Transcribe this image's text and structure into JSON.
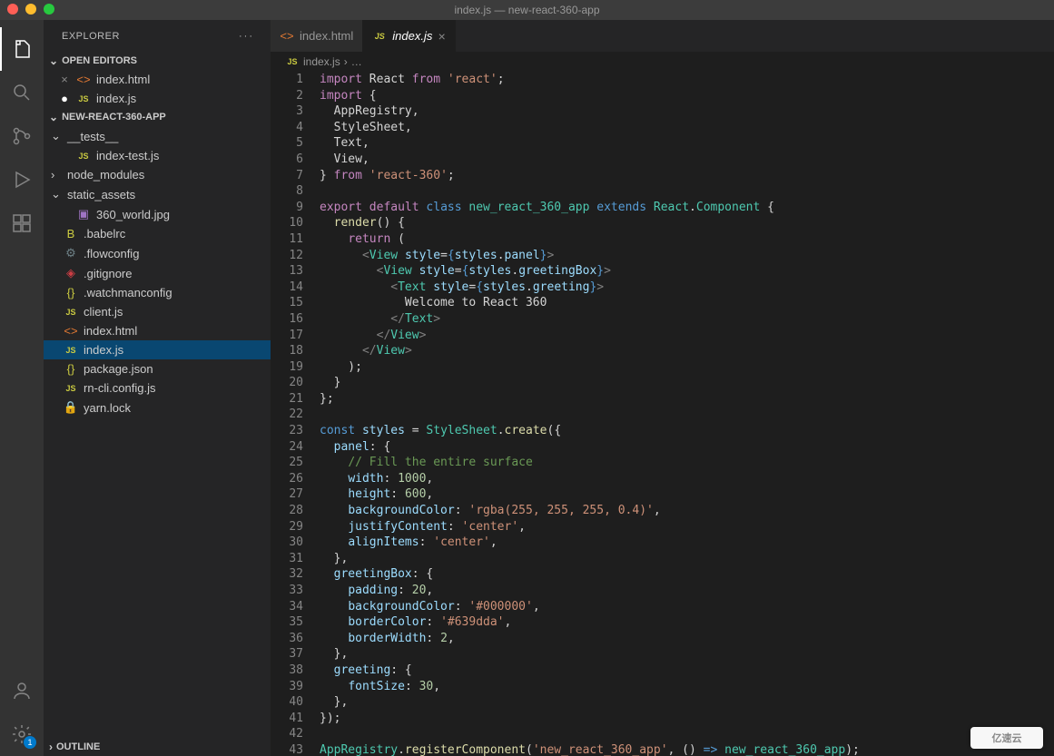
{
  "window": {
    "title": "index.js — new-react-360-app"
  },
  "activity": {
    "icons": [
      "files",
      "search",
      "scm",
      "debug",
      "extensions"
    ],
    "bottom": [
      "account",
      "gear"
    ],
    "badge": "1"
  },
  "sidebar": {
    "title": "EXPLORER",
    "sections": {
      "openEditors": {
        "label": "OPEN EDITORS",
        "items": [
          {
            "name": "index.html",
            "icon": "html",
            "modified": false
          },
          {
            "name": "index.js",
            "icon": "js",
            "modified": true
          }
        ]
      },
      "workspace": {
        "label": "NEW-REACT-360-APP",
        "tree": [
          {
            "name": "__tests__",
            "icon": "folder",
            "indent": 0,
            "chev": "down"
          },
          {
            "name": "index-test.js",
            "icon": "js",
            "indent": 1
          },
          {
            "name": "node_modules",
            "icon": "folder",
            "indent": 0,
            "chev": "right"
          },
          {
            "name": "static_assets",
            "icon": "folder",
            "indent": 0,
            "chev": "down"
          },
          {
            "name": "360_world.jpg",
            "icon": "img",
            "indent": 1
          },
          {
            "name": ".babelrc",
            "icon": "babel",
            "indent": 0
          },
          {
            "name": ".flowconfig",
            "icon": "conf",
            "indent": 0
          },
          {
            "name": ".gitignore",
            "icon": "git",
            "indent": 0
          },
          {
            "name": ".watchmanconfig",
            "icon": "json",
            "indent": 0
          },
          {
            "name": "client.js",
            "icon": "js",
            "indent": 0
          },
          {
            "name": "index.html",
            "icon": "html",
            "indent": 0
          },
          {
            "name": "index.js",
            "icon": "js",
            "indent": 0,
            "selected": true
          },
          {
            "name": "package.json",
            "icon": "json",
            "indent": 0
          },
          {
            "name": "rn-cli.config.js",
            "icon": "js",
            "indent": 0
          },
          {
            "name": "yarn.lock",
            "icon": "lock",
            "indent": 0
          }
        ]
      },
      "outline": {
        "label": "OUTLINE"
      }
    }
  },
  "tabs": [
    {
      "name": "index.html",
      "icon": "html",
      "active": false
    },
    {
      "name": "index.js",
      "icon": "js",
      "active": true
    }
  ],
  "breadcrumb": {
    "file": "index.js",
    "sep": "›",
    "rest": "…"
  },
  "code": {
    "lines": [
      [
        [
          "k",
          "import"
        ],
        [
          "punc",
          " React "
        ],
        [
          "k",
          "from"
        ],
        [
          "punc",
          " "
        ],
        [
          "str",
          "'react'"
        ],
        [
          "punc",
          ";"
        ]
      ],
      [
        [
          "k",
          "import"
        ],
        [
          "punc",
          " {"
        ]
      ],
      [
        [
          "punc",
          "  AppRegistry,"
        ]
      ],
      [
        [
          "punc",
          "  StyleSheet,"
        ]
      ],
      [
        [
          "punc",
          "  Text,"
        ]
      ],
      [
        [
          "punc",
          "  View,"
        ]
      ],
      [
        [
          "punc",
          "} "
        ],
        [
          "k",
          "from"
        ],
        [
          "punc",
          " "
        ],
        [
          "str",
          "'react-360'"
        ],
        [
          "punc",
          ";"
        ]
      ],
      [],
      [
        [
          "k",
          "export"
        ],
        [
          "punc",
          " "
        ],
        [
          "k",
          "default"
        ],
        [
          "punc",
          " "
        ],
        [
          "kb",
          "class"
        ],
        [
          "punc",
          " "
        ],
        [
          "ty",
          "new_react_360_app"
        ],
        [
          "punc",
          " "
        ],
        [
          "kb",
          "extends"
        ],
        [
          "punc",
          " "
        ],
        [
          "ty",
          "React"
        ],
        [
          "punc",
          "."
        ],
        [
          "ty",
          "Component"
        ],
        [
          "punc",
          " {"
        ]
      ],
      [
        [
          "punc",
          "  "
        ],
        [
          "fn",
          "render"
        ],
        [
          "punc",
          "() {"
        ]
      ],
      [
        [
          "punc",
          "    "
        ],
        [
          "k",
          "return"
        ],
        [
          "punc",
          " ("
        ]
      ],
      [
        [
          "punc",
          "      "
        ],
        [
          "pb",
          "<"
        ],
        [
          "tag",
          "View"
        ],
        [
          "punc",
          " "
        ],
        [
          "attr",
          "style"
        ],
        [
          "punc",
          "="
        ],
        [
          "kb",
          "{"
        ],
        [
          "prop",
          "styles"
        ],
        [
          "punc",
          "."
        ],
        [
          "prop",
          "panel"
        ],
        [
          "kb",
          "}"
        ],
        [
          "pb",
          ">"
        ]
      ],
      [
        [
          "punc",
          "        "
        ],
        [
          "pb",
          "<"
        ],
        [
          "tag",
          "View"
        ],
        [
          "punc",
          " "
        ],
        [
          "attr",
          "style"
        ],
        [
          "punc",
          "="
        ],
        [
          "kb",
          "{"
        ],
        [
          "prop",
          "styles"
        ],
        [
          "punc",
          "."
        ],
        [
          "prop",
          "greetingBox"
        ],
        [
          "kb",
          "}"
        ],
        [
          "pb",
          ">"
        ]
      ],
      [
        [
          "punc",
          "          "
        ],
        [
          "pb",
          "<"
        ],
        [
          "tag",
          "Text"
        ],
        [
          "punc",
          " "
        ],
        [
          "attr",
          "style"
        ],
        [
          "punc",
          "="
        ],
        [
          "kb",
          "{"
        ],
        [
          "prop",
          "styles"
        ],
        [
          "punc",
          "."
        ],
        [
          "prop",
          "greeting"
        ],
        [
          "kb",
          "}"
        ],
        [
          "pb",
          ">"
        ]
      ],
      [
        [
          "punc",
          "            Welcome to React 360"
        ]
      ],
      [
        [
          "punc",
          "          "
        ],
        [
          "pb",
          "</"
        ],
        [
          "tag",
          "Text"
        ],
        [
          "pb",
          ">"
        ]
      ],
      [
        [
          "punc",
          "        "
        ],
        [
          "pb",
          "</"
        ],
        [
          "tag",
          "View"
        ],
        [
          "pb",
          ">"
        ]
      ],
      [
        [
          "punc",
          "      "
        ],
        [
          "pb",
          "</"
        ],
        [
          "tag",
          "View"
        ],
        [
          "pb",
          ">"
        ]
      ],
      [
        [
          "punc",
          "    );"
        ]
      ],
      [
        [
          "punc",
          "  }"
        ]
      ],
      [
        [
          "punc",
          "};"
        ]
      ],
      [],
      [
        [
          "kb",
          "const"
        ],
        [
          "punc",
          " "
        ],
        [
          "prop",
          "styles"
        ],
        [
          "punc",
          " = "
        ],
        [
          "ty",
          "StyleSheet"
        ],
        [
          "punc",
          "."
        ],
        [
          "fn",
          "create"
        ],
        [
          "punc",
          "({"
        ]
      ],
      [
        [
          "punc",
          "  "
        ],
        [
          "prop",
          "panel"
        ],
        [
          "punc",
          ": {"
        ]
      ],
      [
        [
          "punc",
          "    "
        ],
        [
          "cm",
          "// Fill the entire surface"
        ]
      ],
      [
        [
          "punc",
          "    "
        ],
        [
          "prop",
          "width"
        ],
        [
          "punc",
          ": "
        ],
        [
          "num",
          "1000"
        ],
        [
          "punc",
          ","
        ]
      ],
      [
        [
          "punc",
          "    "
        ],
        [
          "prop",
          "height"
        ],
        [
          "punc",
          ": "
        ],
        [
          "num",
          "600"
        ],
        [
          "punc",
          ","
        ]
      ],
      [
        [
          "punc",
          "    "
        ],
        [
          "prop",
          "backgroundColor"
        ],
        [
          "punc",
          ": "
        ],
        [
          "str",
          "'rgba(255, 255, 255, 0.4)'"
        ],
        [
          "punc",
          ","
        ]
      ],
      [
        [
          "punc",
          "    "
        ],
        [
          "prop",
          "justifyContent"
        ],
        [
          "punc",
          ": "
        ],
        [
          "str",
          "'center'"
        ],
        [
          "punc",
          ","
        ]
      ],
      [
        [
          "punc",
          "    "
        ],
        [
          "prop",
          "alignItems"
        ],
        [
          "punc",
          ": "
        ],
        [
          "str",
          "'center'"
        ],
        [
          "punc",
          ","
        ]
      ],
      [
        [
          "punc",
          "  },"
        ]
      ],
      [
        [
          "punc",
          "  "
        ],
        [
          "prop",
          "greetingBox"
        ],
        [
          "punc",
          ": {"
        ]
      ],
      [
        [
          "punc",
          "    "
        ],
        [
          "prop",
          "padding"
        ],
        [
          "punc",
          ": "
        ],
        [
          "num",
          "20"
        ],
        [
          "punc",
          ","
        ]
      ],
      [
        [
          "punc",
          "    "
        ],
        [
          "prop",
          "backgroundColor"
        ],
        [
          "punc",
          ": "
        ],
        [
          "str",
          "'#000000'"
        ],
        [
          "punc",
          ","
        ]
      ],
      [
        [
          "punc",
          "    "
        ],
        [
          "prop",
          "borderColor"
        ],
        [
          "punc",
          ": "
        ],
        [
          "str",
          "'#639dda'"
        ],
        [
          "punc",
          ","
        ]
      ],
      [
        [
          "punc",
          "    "
        ],
        [
          "prop",
          "borderWidth"
        ],
        [
          "punc",
          ": "
        ],
        [
          "num",
          "2"
        ],
        [
          "punc",
          ","
        ]
      ],
      [
        [
          "punc",
          "  },"
        ]
      ],
      [
        [
          "punc",
          "  "
        ],
        [
          "prop",
          "greeting"
        ],
        [
          "punc",
          ": {"
        ]
      ],
      [
        [
          "punc",
          "    "
        ],
        [
          "prop",
          "fontSize"
        ],
        [
          "punc",
          ": "
        ],
        [
          "num",
          "30"
        ],
        [
          "punc",
          ","
        ]
      ],
      [
        [
          "punc",
          "  },"
        ]
      ],
      [
        [
          "punc",
          "});"
        ]
      ],
      [],
      [
        [
          "ty",
          "AppRegistry"
        ],
        [
          "punc",
          "."
        ],
        [
          "fn",
          "registerComponent"
        ],
        [
          "punc",
          "("
        ],
        [
          "str",
          "'new_react_360_app'"
        ],
        [
          "punc",
          ", () "
        ],
        [
          "kb",
          "=>"
        ],
        [
          "punc",
          " "
        ],
        [
          "ty",
          "new_react_360_app"
        ],
        [
          "punc",
          ");"
        ]
      ]
    ]
  },
  "watermark": "亿速云"
}
